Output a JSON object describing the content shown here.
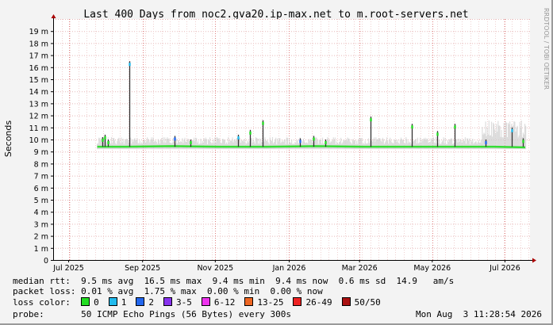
{
  "watermark": "RRDTOOL / TOBI OETIKER",
  "stats": {
    "median_rtt": "median rtt:  9.5 ms avg  16.5 ms max  9.4 ms min  9.4 ms now  0.6 ms sd  14.9   am/s",
    "packet_loss": "packet loss: 0.01 % avg  1.75 % max  0.00 % min  0.00 % now"
  },
  "loss_color": {
    "label": "loss color:",
    "items": [
      {
        "label": "0",
        "color": "#22dd22"
      },
      {
        "label": "1",
        "color": "#22bbee"
      },
      {
        "label": "2",
        "color": "#2266ee"
      },
      {
        "label": "3-5",
        "color": "#8833ee"
      },
      {
        "label": "6-12",
        "color": "#ee33ee"
      },
      {
        "label": "13-25",
        "color": "#ee6622"
      },
      {
        "label": "26-49",
        "color": "#ee2222"
      },
      {
        "label": "50/50",
        "color": "#aa1111"
      }
    ]
  },
  "probe": {
    "label": "probe:       50 ICMP Echo Pings (56 Bytes) every 300s",
    "timestamp": "Mon Aug  3 11:28:54 2026"
  },
  "chart_data": {
    "type": "line",
    "title": "Last 400 Days from noc2.gva20.ip-max.net to m.root-servers.net",
    "ylabel": "Seconds",
    "xlabel": "",
    "y_tick_labels": [
      "0",
      "1 m",
      "2 m",
      "3 m",
      "4 m",
      "5 m",
      "6 m",
      "7 m",
      "8 m",
      "9 m",
      "10 m",
      "11 m",
      "12 m",
      "13 m",
      "14 m",
      "15 m",
      "16 m",
      "17 m",
      "18 m",
      "19 m"
    ],
    "x_tick_labels": [
      "Jul 2025",
      "Sep 2025",
      "Nov 2025",
      "Jan 2026",
      "Mar 2026",
      "May 2026",
      "Jul 2026"
    ],
    "ylim": [
      0,
      20
    ],
    "x_range_days": [
      0,
      400
    ],
    "x_tick_days": [
      13,
      75,
      136,
      198,
      257,
      318,
      379
    ],
    "grid": true,
    "median_series": {
      "name": "median rtt",
      "points": [
        [
          37,
          9.4
        ],
        [
          60,
          9.4
        ],
        [
          100,
          9.45
        ],
        [
          140,
          9.4
        ],
        [
          180,
          9.4
        ],
        [
          220,
          9.45
        ],
        [
          260,
          9.4
        ],
        [
          300,
          9.4
        ],
        [
          340,
          9.4
        ],
        [
          370,
          9.4
        ],
        [
          396,
          9.35
        ]
      ]
    },
    "smoke_bands": [
      {
        "from": 37,
        "to": 360,
        "lo": 9.2,
        "hi": 10.2
      },
      {
        "from": 360,
        "to": 397,
        "lo": 9.2,
        "hi": 11.6
      }
    ],
    "spikes": [
      {
        "x": 41,
        "y": 10.2,
        "loss": "0"
      },
      {
        "x": 43,
        "y": 10.4,
        "loss": "0"
      },
      {
        "x": 46,
        "y": 10.0,
        "loss": "0"
      },
      {
        "x": 64,
        "y": 16.5,
        "loss": "1"
      },
      {
        "x": 102,
        "y": 10.3,
        "loss": "2"
      },
      {
        "x": 115,
        "y": 10.0,
        "loss": "0"
      },
      {
        "x": 155,
        "y": 10.4,
        "loss": "1"
      },
      {
        "x": 165,
        "y": 10.8,
        "loss": "0"
      },
      {
        "x": 176,
        "y": 11.6,
        "loss": "0"
      },
      {
        "x": 207,
        "y": 10.1,
        "loss": "2"
      },
      {
        "x": 218,
        "y": 10.3,
        "loss": "0"
      },
      {
        "x": 228,
        "y": 10.0,
        "loss": "0"
      },
      {
        "x": 266,
        "y": 11.9,
        "loss": "0"
      },
      {
        "x": 301,
        "y": 11.3,
        "loss": "0"
      },
      {
        "x": 322,
        "y": 10.7,
        "loss": "0"
      },
      {
        "x": 337,
        "y": 11.3,
        "loss": "0"
      },
      {
        "x": 363,
        "y": 10.0,
        "loss": "2"
      },
      {
        "x": 385,
        "y": 11.0,
        "loss": "1"
      },
      {
        "x": 394,
        "y": 10.1,
        "loss": "0"
      }
    ]
  }
}
